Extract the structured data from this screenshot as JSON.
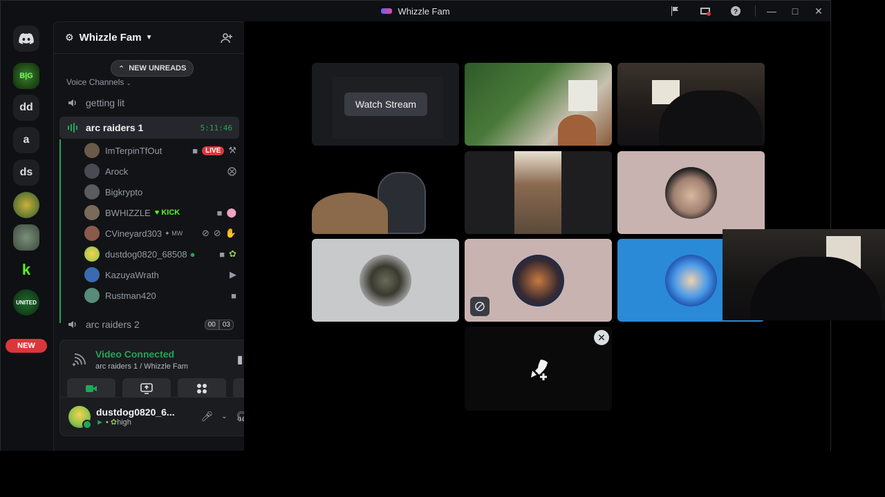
{
  "window": {
    "title": "Whizzle Fam"
  },
  "rail": {
    "servers": [
      {
        "label": "",
        "name": "discord-home"
      },
      {
        "label": "",
        "name": "bigkrypto"
      },
      {
        "label": "dd",
        "name": "dd"
      },
      {
        "label": "a",
        "name": "a"
      },
      {
        "label": "ds",
        "name": "ds"
      },
      {
        "label": "",
        "name": "server-crown"
      },
      {
        "label": "",
        "name": "server-avatar"
      },
      {
        "label": "",
        "name": "kick"
      },
      {
        "label": "",
        "name": "united"
      }
    ],
    "new_badge": "NEW"
  },
  "guild": {
    "name": "Whizzle Fam"
  },
  "sidebar": {
    "new_unreads": "NEW UNREADS",
    "category": "Voice Channels",
    "channels": [
      {
        "name": "getting lit"
      },
      {
        "name": "arc raiders 1",
        "timer": "5:11:46"
      },
      {
        "name": "arc raiders 2",
        "count_a": "00",
        "count_b": "03"
      }
    ],
    "members": [
      {
        "name": "ImTerpinTfOut",
        "live": "LIVE"
      },
      {
        "name": "Arock"
      },
      {
        "name": "Bigkrypto"
      },
      {
        "name": "BWHIZZLE",
        "tag": "KICK"
      },
      {
        "name": "CVineyard303",
        "tag": "MW"
      },
      {
        "name": "dustdog0820_68508"
      },
      {
        "name": "KazuyaWrath"
      },
      {
        "name": "Rustman420"
      }
    ]
  },
  "voice": {
    "status": "Video Connected",
    "channel": "arc raiders 1 / Whizzle Fam"
  },
  "user": {
    "name": "dustdog0820_6...",
    "status": "high"
  },
  "stage": {
    "watch_stream": "Watch Stream"
  },
  "colors": {
    "accent_green": "#23a55a",
    "live_red": "#da373c",
    "kick_green": "#53fc18"
  }
}
